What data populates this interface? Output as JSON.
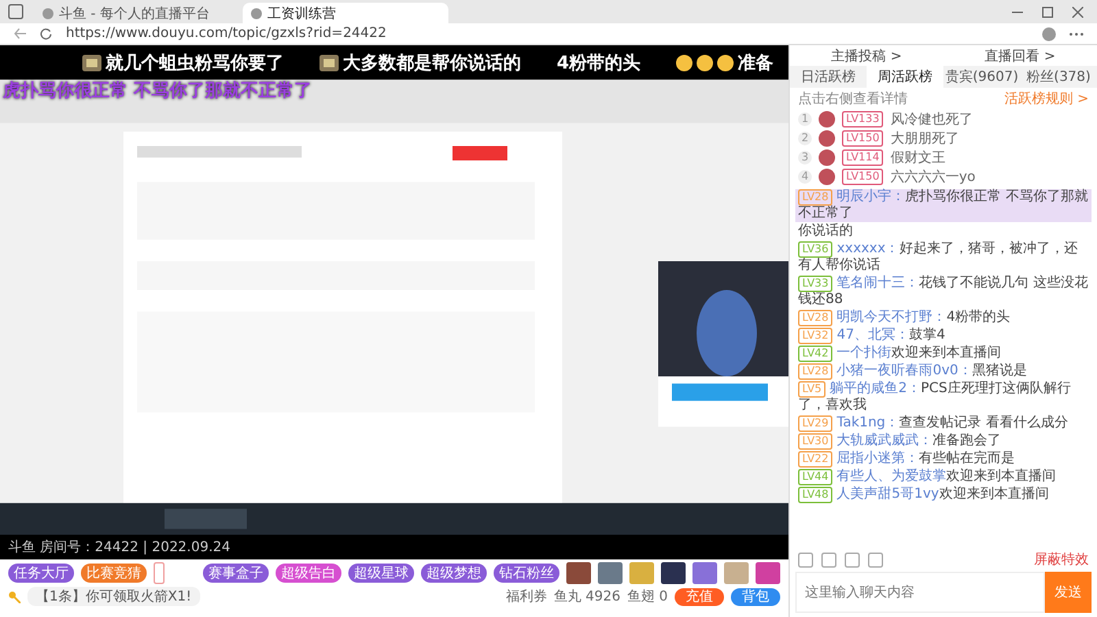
{
  "browser": {
    "tabs": [
      {
        "title": "斗鱼 - 每个人的直播平台",
        "selected": false
      },
      {
        "title": "工资训练营",
        "selected": true
      }
    ],
    "url": "https://www.douyu.com/topic/gzxls?rid=24422"
  },
  "player": {
    "danmaku_lanes": [
      [
        {
          "text": "就几个蛆虫粉骂你要了",
          "color": "#ffffff",
          "kind": "badge"
        },
        {
          "text": "大多数都是帮你说话的",
          "color": "#ffffff",
          "kind": "badge"
        },
        {
          "text": "4粉带的头",
          "color": "#ffffff",
          "kind": "plain"
        },
        {
          "text": "准备",
          "color": "#ffffff",
          "kind": "emoji"
        }
      ],
      [
        {
          "text": "虎扑骂你很正常 不骂你了那就不正常了",
          "color": "#9b3fe0",
          "kind": "plain"
        }
      ]
    ],
    "room_info": "斗鱼 房间号：24422 | 2022.09.24"
  },
  "toolbar": {
    "activities": [
      {
        "label": "任务大厅",
        "color": "#8a5cd8"
      },
      {
        "label": "比赛竞猜",
        "color": "#f07a2a"
      }
    ],
    "gift_activities": [
      {
        "label": "赛事盒子",
        "color": "#8a5cd8"
      },
      {
        "label": "超级告白",
        "color": "#d64fd0"
      },
      {
        "label": "超级星球",
        "color": "#8a5cd8"
      },
      {
        "label": "超级梦想",
        "color": "#8a5cd8"
      },
      {
        "label": "钻石粉丝",
        "color": "#8a5cd8"
      }
    ],
    "notice": "【1条】你可领取火箭X1!",
    "wallet": [
      "福利券",
      "鱼丸 4926",
      "鱼翅 0"
    ],
    "buttons": [
      {
        "label": "充值",
        "kind": "primary"
      },
      {
        "label": "背包",
        "kind": "secondary"
      }
    ]
  },
  "sidebar": {
    "links": [
      "主播投稿 >",
      "直播回看 >"
    ],
    "tabs": [
      {
        "label": "日活跃榜",
        "selected": false
      },
      {
        "label": "周活跃榜",
        "selected": true
      },
      {
        "label": "贵宾(9607)",
        "selected": false
      },
      {
        "label": "粉丝(378)",
        "selected": false
      }
    ],
    "hint": "点击右侧查看详情",
    "rule_link": "活跃榜规则 >",
    "ranks": [
      {
        "rank": "1",
        "level": "LV133",
        "name": "风冷健也死了"
      },
      {
        "rank": "2",
        "level": "LV150",
        "name": "大朋朋死了"
      },
      {
        "rank": "3",
        "level": "LV114",
        "name": "假财文王"
      },
      {
        "rank": "4",
        "level": "LV150",
        "name": "六六六六一yo"
      }
    ],
    "chat": [
      {
        "level": "LV28",
        "color": "#f5a04a",
        "name": "明辰小宇：",
        "text": "虎扑骂你很正常 不骂你了那就不正常了",
        "highlighted": true
      },
      {
        "text": "你说话的",
        "highlighted": false
      },
      {
        "level": "LV36",
        "color": "#7cbf3a",
        "name": "xxxxxx：",
        "text": "好起来了，猪哥，被冲了，还有人帮你说话",
        "highlighted": false
      },
      {
        "level": "LV33",
        "color": "#7cbf3a",
        "name": "笔名闹十三：",
        "text": "花钱了不能说几句 这些没花钱还88",
        "highlighted": false
      },
      {
        "level": "LV28",
        "color": "#f5a04a",
        "name": "明凯今天不打野：",
        "text": "4粉带的头",
        "highlighted": false
      },
      {
        "level": "LV32",
        "color": "#f5a04a",
        "name": "47、北冥：",
        "text": "鼓掌4",
        "highlighted": false
      },
      {
        "level": "LV42",
        "color": "#7cbf3a",
        "name": "一个扑街",
        "text": "欢迎来到本直播间",
        "highlighted": false
      },
      {
        "level": "LV28",
        "color": "#f5a04a",
        "name": "小猪一夜听春雨0v0：",
        "text": "黑猪说是",
        "highlighted": false
      },
      {
        "level": "LV5",
        "color": "#f5a04a",
        "name": "躺平的咸鱼2：",
        "text": "PCS庄死理打这俩队解行了，喜欢我",
        "highlighted": false
      },
      {
        "level": "LV29",
        "color": "#f5a04a",
        "name": "Tak1ng：",
        "text": "查查发帖记录 看看什么成分",
        "highlighted": false
      },
      {
        "level": "LV30",
        "color": "#f5a04a",
        "name": "大轨威武威武：",
        "text": "准备跑会了",
        "highlighted": false
      },
      {
        "level": "LV22",
        "color": "#f5a04a",
        "name": "屈指小迷第：",
        "text": "有些帖在完而是",
        "highlighted": false
      },
      {
        "level": "LV44",
        "color": "#7cbf3a",
        "name": "有些人、为爱鼓掌",
        "text": "欢迎来到本直播间",
        "highlighted": false
      },
      {
        "level": "LV48",
        "color": "#7cbf3a",
        "name": "人美声甜5哥1vy",
        "text": "欢迎来到本直播间",
        "highlighted": false
      }
    ],
    "shield": "屏蔽特效",
    "input": {
      "placeholder": "这里输入聊天内容"
    },
    "send": "发送"
  }
}
